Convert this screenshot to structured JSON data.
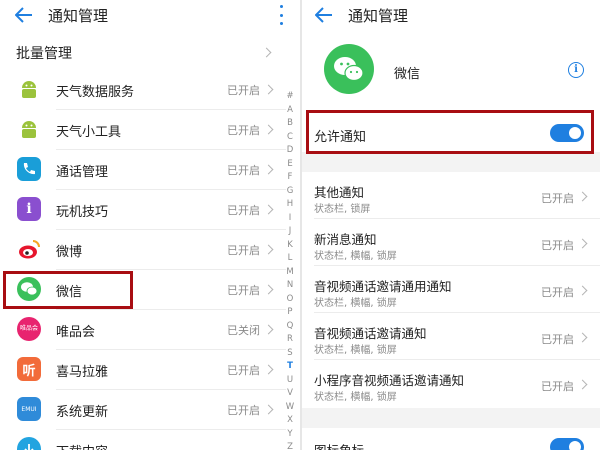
{
  "left": {
    "title": "通知管理",
    "batch_label": "批量管理",
    "apps": [
      {
        "name": "天气数据服务",
        "status": "已开启",
        "icon": "android-icon"
      },
      {
        "name": "天气小工具",
        "status": "已开启",
        "icon": "android-icon"
      },
      {
        "name": "通话管理",
        "status": "已开启",
        "icon": "phone-icon"
      },
      {
        "name": "玩机技巧",
        "status": "已开启",
        "icon": "tips-icon"
      },
      {
        "name": "微博",
        "status": "已开启",
        "icon": "weibo-icon"
      },
      {
        "name": "微信",
        "status": "已开启",
        "icon": "wechat-icon"
      },
      {
        "name": "唯品会",
        "status": "已关闭",
        "icon": "vipshop-icon"
      },
      {
        "name": "喜马拉雅",
        "status": "已开启",
        "icon": "ximalaya-icon"
      },
      {
        "name": "系统更新",
        "status": "已开启",
        "icon": "system-update-icon"
      },
      {
        "name": "下载内容",
        "status": "",
        "icon": "download-icon"
      }
    ],
    "alphabet": [
      "#",
      "A",
      "B",
      "C",
      "D",
      "E",
      "F",
      "G",
      "H",
      "I",
      "J",
      "K",
      "L",
      "M",
      "N",
      "O",
      "P",
      "Q",
      "R",
      "S",
      "T",
      "U",
      "V",
      "W",
      "X",
      "Y",
      "Z"
    ],
    "alphabet_active": "T",
    "icon_text": {
      "vipshop": "唯品会",
      "ximalaya": "听",
      "system_update": "EMUI"
    }
  },
  "right": {
    "title": "通知管理",
    "app_name": "微信",
    "allow_label": "允许通知",
    "allow_on": true,
    "notifications": [
      {
        "title": "其他通知",
        "sub": "状态栏, 锁屏",
        "status": "已开启"
      },
      {
        "title": "新消息通知",
        "sub": "状态栏, 横幅, 锁屏",
        "status": "已开启"
      },
      {
        "title": "音视频通话邀请通用通知",
        "sub": "状态栏, 横幅, 锁屏",
        "status": "已开启"
      },
      {
        "title": "音视频通话邀请通知",
        "sub": "状态栏, 横幅, 锁屏",
        "status": "已开启"
      },
      {
        "title": "小程序音视频通话邀请通知",
        "sub": "状态栏, 横幅, 锁屏",
        "status": "已开启"
      }
    ],
    "bottom_label": "图标角标"
  },
  "colors": {
    "accent": "#1f7fe0",
    "highlight": "#a80d12",
    "wechat_green": "#3ac05b"
  }
}
